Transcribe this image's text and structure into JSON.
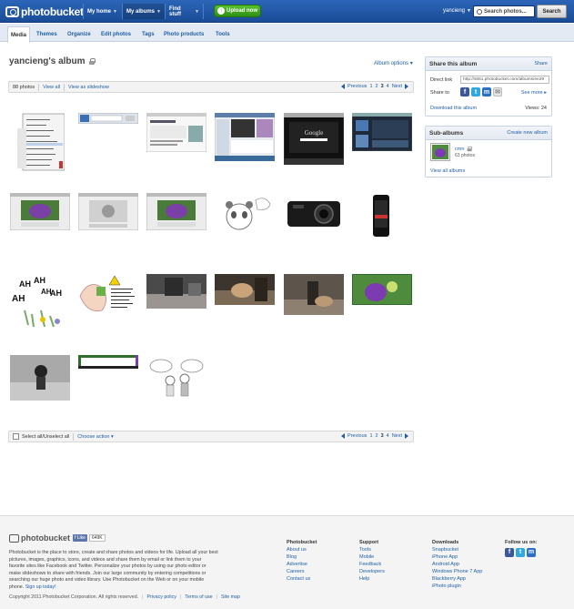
{
  "header": {
    "logo": "photobucket",
    "nav": [
      {
        "label": "My home"
      },
      {
        "label": "My albums"
      },
      {
        "label": "Find stuff"
      }
    ],
    "upload_label": "Upload now",
    "username": "yancieng",
    "search_placeholder": "Search photos...",
    "search_button": "Search"
  },
  "subnav": {
    "tabs": [
      "Media",
      "Themes",
      "Organize",
      "Edit photos",
      "Tags",
      "Photo products",
      "Tools"
    ],
    "active": "Media"
  },
  "album": {
    "title": "yancieng's album",
    "options_label": "Album options",
    "count_label": "88 photos",
    "view_all": "View all",
    "view_slideshow": "View as slideshow",
    "select_all": "Select all",
    "unselect_all": "Unselect all",
    "choose_action": "Choose action"
  },
  "pager": {
    "previous": "Previous",
    "pages": [
      "1",
      "2",
      "3",
      "4"
    ],
    "current": "3",
    "next": "Next"
  },
  "share": {
    "title": "Share this album",
    "share_link": "Share",
    "direct_link_label": "Direct link",
    "direct_link_value": "http://s861.photobucket.com/albums/ee29",
    "share_to_label": "Share to",
    "see_more": "See more",
    "download": "Download this album",
    "views": "Views: 24"
  },
  "subalbums": {
    "title": "Sub-albums",
    "create": "Create new album",
    "items": [
      {
        "name": "cmn",
        "count": "63 photos"
      }
    ],
    "view_all": "View all albums"
  },
  "thumbnails": [
    {
      "kind": "menu"
    },
    {
      "kind": "browser"
    },
    {
      "kind": "web-white"
    },
    {
      "kind": "web-mixed"
    },
    {
      "kind": "google-dark"
    },
    {
      "kind": "web-dark"
    },
    {
      "kind": "purple-site"
    },
    {
      "kind": "grey-site"
    },
    {
      "kind": "purple-site"
    },
    {
      "kind": "sketch-panda"
    },
    {
      "kind": "camera-phone"
    },
    {
      "kind": "touch-phone"
    },
    {
      "kind": "ah-drawing"
    },
    {
      "kind": "sketch-chat"
    },
    {
      "kind": "dark-photo"
    },
    {
      "kind": "dog-photo"
    },
    {
      "kind": "dog-photo-2"
    },
    {
      "kind": "green-purple"
    },
    {
      "kind": "grey-girl"
    },
    {
      "kind": "frame-strip"
    },
    {
      "kind": "sketch-people"
    }
  ],
  "footer": {
    "logo": "photobucket",
    "like_label": "Like",
    "like_count": "649K",
    "about": "Photobucket is the place to store, create and share photos and videos for life. Upload all your best pictures, images, graphics, icons, and videos and share them by email or link them to your favorite sites like Facebook and Twitter. Personalize your photos by using our photo editor or make slideshows to share with friends. Join our large community by entering competitions or searching our huge photo and video library. Use Photobucket on the Web or on your mobile phone.",
    "signup": "Sign up today!",
    "columns": [
      {
        "title": "Photobucket",
        "links": [
          "About us",
          "Blog",
          "Advertise",
          "Careers",
          "Contact us"
        ]
      },
      {
        "title": "Support",
        "links": [
          "Tools",
          "Mobile",
          "Feedback",
          "Developers",
          "Help"
        ]
      },
      {
        "title": "Downloads",
        "links": [
          "Snapbucket",
          "iPhone App",
          "Android App",
          "Windows Phone 7 App",
          "Blackberry App",
          "iPhoto plugin"
        ]
      }
    ],
    "follow_title": "Follow us on:",
    "copyright": "Copyright 2011 Photobucket Corporation.  All rights reserved.",
    "legal_links": [
      "Privacy policy",
      "Terms of use",
      "Site map"
    ]
  },
  "colors": {
    "topbar": "#2c66b8",
    "upload": "#3aa51c",
    "link": "#1f5fa6",
    "facebook": "#3b5998",
    "twitter": "#2fa9e0"
  }
}
